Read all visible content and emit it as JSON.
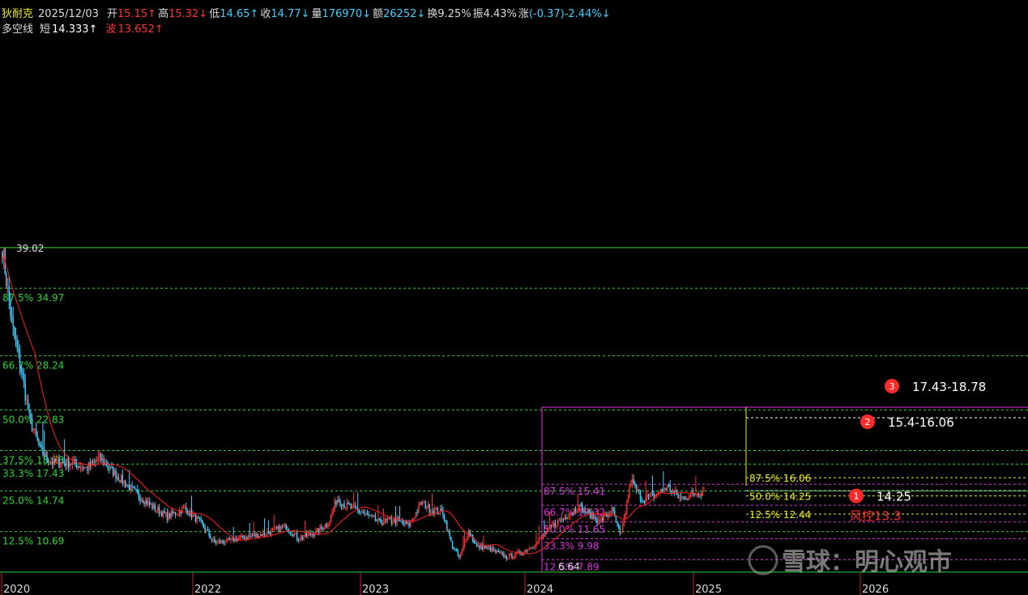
{
  "header": {
    "name": "狄耐克",
    "date": "2025/12/03",
    "fields": [
      {
        "label": "开",
        "value": "15.15↑",
        "color": "#ff3333"
      },
      {
        "label": "高",
        "value": "15.32↓",
        "color": "#ff3333"
      },
      {
        "label": "低",
        "value": "14.65↑",
        "color": "#44d0ff"
      },
      {
        "label": "收",
        "value": "14.77↓",
        "color": "#44d0ff"
      },
      {
        "label": "量",
        "value": "176970↓",
        "color": "#44d0ff"
      },
      {
        "label": "额",
        "value": "26252↓",
        "color": "#44d0ff"
      },
      {
        "label": "换",
        "value": "9.25%",
        "color": "#dddddd"
      },
      {
        "label": "振",
        "value": "4.43%",
        "color": "#dddddd"
      },
      {
        "label": "涨",
        "value": "(-0.37)-2.44%↓",
        "color": "#44d0ff"
      }
    ],
    "indicator_name": "多空线",
    "short_label": "短",
    "short_value": "14.333↑",
    "wave_label": "波",
    "wave_value": "13.652↑"
  },
  "colors": {
    "up": "#ff3333",
    "down": "#44d0ff",
    "ma": "#ff2020",
    "green_level": "#2fd62f",
    "magenta_level": "#dd33dd",
    "yellow_level": "#eded2a",
    "white_level": "#dddddd"
  },
  "chart_data": {
    "type": "candlestick",
    "x_axis_labels": [
      "2020",
      "2022",
      "2023",
      "2024",
      "2025",
      "2026"
    ],
    "ylim": [
      6.64,
      39.02
    ],
    "high_label": "39.02",
    "low_label": "6.64",
    "fib_levels_full": [
      {
        "label": "87.5% 34.97",
        "value": 34.97
      },
      {
        "label": "66.7% 28.24",
        "value": 28.24
      },
      {
        "label": "50.0% 22.83",
        "value": 22.83
      },
      {
        "label": "37.5% 18.78",
        "value": 18.78
      },
      {
        "label": "33.3% 17.43",
        "value": 17.43
      },
      {
        "label": "25.0% 14.74",
        "value": 14.74
      },
      {
        "label": "12.5% 10.69",
        "value": 10.69
      }
    ],
    "fib_levels_mid": [
      {
        "label": "87.5% 15.41",
        "value": 15.41
      },
      {
        "label": "66.7% 13.32",
        "value": 13.32
      },
      {
        "label": "50.0% 11.65",
        "value": 11.65
      },
      {
        "label": "33.3% 9.98",
        "value": 9.98
      },
      {
        "label": "12.5% 7.89",
        "value": 7.89
      }
    ],
    "fib_levels_recent": [
      {
        "label": "87.5% 16.06",
        "value": 16.06
      },
      {
        "label": "50.0% 14.25",
        "value": 14.25
      },
      {
        "label": "12.5% 12.44",
        "value": 12.44
      }
    ],
    "targets": [
      {
        "num": "1",
        "text": "14.25",
        "value": 14.25
      },
      {
        "num": "2",
        "text": "15.4-16.06",
        "value": 16.06
      },
      {
        "num": "3",
        "text": "17.43-18.78",
        "value": 18.78
      }
    ],
    "risk_label": "风控13.3",
    "risk_value": 13.3,
    "anchors": [
      {
        "t": 0.0,
        "p": 39.02
      },
      {
        "t": 0.012,
        "p": 31.0
      },
      {
        "t": 0.022,
        "p": 27.0
      },
      {
        "t": 0.032,
        "p": 22.0
      },
      {
        "t": 0.045,
        "p": 18.8
      },
      {
        "t": 0.06,
        "p": 17.5
      },
      {
        "t": 0.08,
        "p": 17.6
      },
      {
        "t": 0.1,
        "p": 17.0
      },
      {
        "t": 0.115,
        "p": 18.0
      },
      {
        "t": 0.135,
        "p": 16.3
      },
      {
        "t": 0.155,
        "p": 14.7
      },
      {
        "t": 0.175,
        "p": 13.3
      },
      {
        "t": 0.195,
        "p": 12.2
      },
      {
        "t": 0.215,
        "p": 13.0
      },
      {
        "t": 0.235,
        "p": 11.5
      },
      {
        "t": 0.25,
        "p": 9.6
      },
      {
        "t": 0.265,
        "p": 9.7
      },
      {
        "t": 0.285,
        "p": 10.1
      },
      {
        "t": 0.31,
        "p": 10.5
      },
      {
        "t": 0.335,
        "p": 11.2
      },
      {
        "t": 0.35,
        "p": 10.0
      },
      {
        "t": 0.37,
        "p": 10.6
      },
      {
        "t": 0.385,
        "p": 11.6
      },
      {
        "t": 0.395,
        "p": 14.0
      },
      {
        "t": 0.405,
        "p": 13.3
      },
      {
        "t": 0.425,
        "p": 12.6
      },
      {
        "t": 0.445,
        "p": 11.6
      },
      {
        "t": 0.465,
        "p": 11.8
      },
      {
        "t": 0.48,
        "p": 11.3
      },
      {
        "t": 0.495,
        "p": 13.6
      },
      {
        "t": 0.505,
        "p": 12.9
      },
      {
        "t": 0.52,
        "p": 12.6
      },
      {
        "t": 0.53,
        "p": 9.5
      },
      {
        "t": 0.54,
        "p": 8.0
      },
      {
        "t": 0.55,
        "p": 10.8
      },
      {
        "t": 0.56,
        "p": 9.2
      },
      {
        "t": 0.575,
        "p": 9.0
      },
      {
        "t": 0.595,
        "p": 8.1
      },
      {
        "t": 0.615,
        "p": 8.7
      },
      {
        "t": 0.63,
        "p": 9.5
      },
      {
        "t": 0.645,
        "p": 11.0
      },
      {
        "t": 0.665,
        "p": 12.2
      },
      {
        "t": 0.68,
        "p": 13.2
      },
      {
        "t": 0.695,
        "p": 12.3
      },
      {
        "t": 0.705,
        "p": 11.7
      },
      {
        "t": 0.72,
        "p": 12.8
      },
      {
        "t": 0.73,
        "p": 10.1
      },
      {
        "t": 0.742,
        "p": 15.8
      },
      {
        "t": 0.755,
        "p": 13.9
      },
      {
        "t": 0.77,
        "p": 14.3
      },
      {
        "t": 0.785,
        "p": 15.2
      },
      {
        "t": 0.8,
        "p": 14.0
      },
      {
        "t": 0.815,
        "p": 14.4
      },
      {
        "t": 0.828,
        "p": 14.77
      }
    ]
  },
  "watermark": "雪球：明心观市"
}
